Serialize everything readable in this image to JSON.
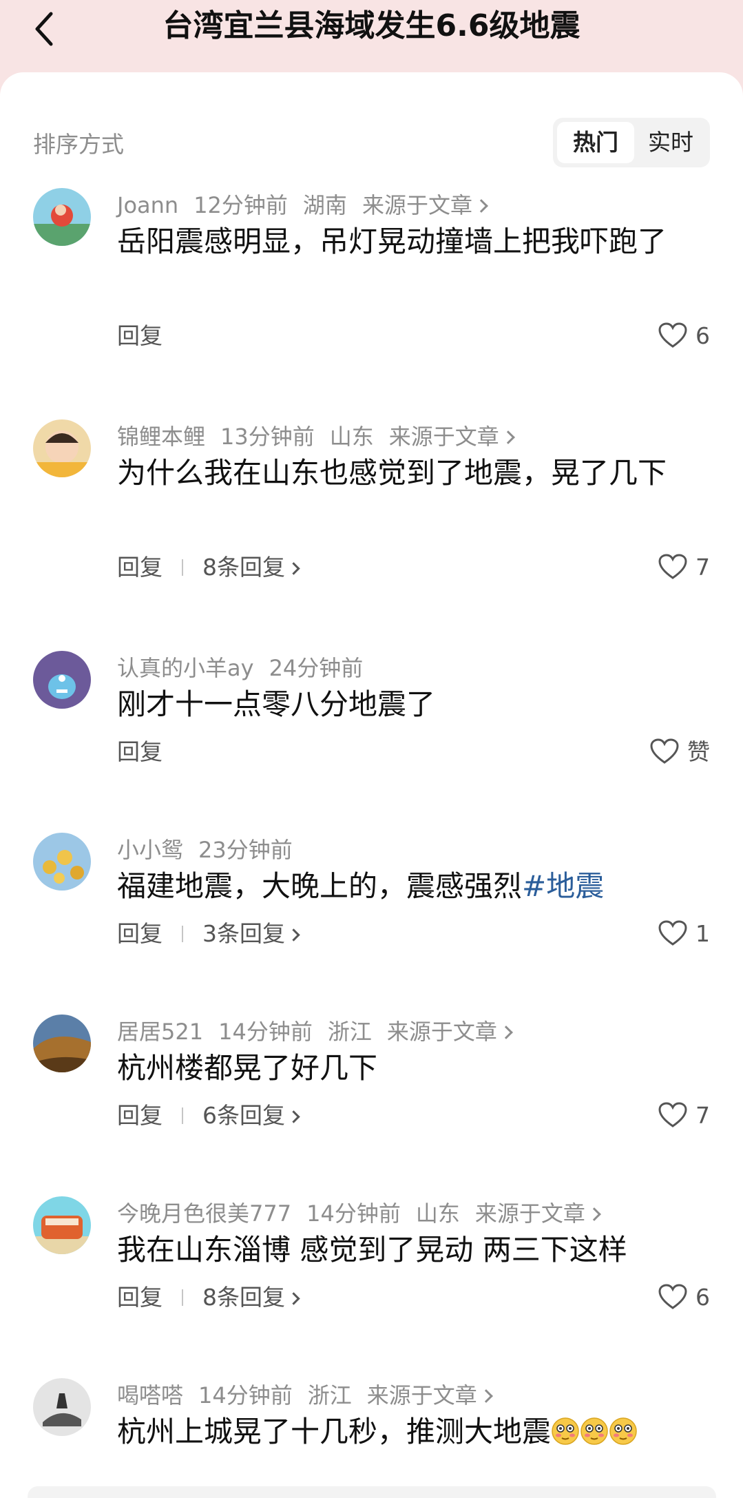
{
  "header": {
    "title": "台湾宜兰县海域发生6.6级地震"
  },
  "sort": {
    "label": "排序方式",
    "hot": "热门",
    "live": "实时"
  },
  "comments": [
    {
      "user": "Joann",
      "time": "12分钟前",
      "location": "湖南",
      "source": "来源于文章",
      "text": "岳阳震感明显，吊灯晃动撞墙上把我吓跑了",
      "reply_label": "回复",
      "replies": "",
      "likes": "6"
    },
    {
      "user": "锦鲤本鲤",
      "time": "13分钟前",
      "location": "山东",
      "source": "来源于文章",
      "text": "为什么我在山东也感觉到了地震，晃了几下",
      "reply_label": "回复",
      "replies": "8条回复",
      "likes": "7"
    },
    {
      "user": "认真的小羊ay",
      "time": "24分钟前",
      "location": "",
      "source": "",
      "text": "刚才十一点零八分地震了",
      "reply_label": "回复",
      "replies": "",
      "likes": "赞"
    },
    {
      "user": "小小鸳",
      "time": "23分钟前",
      "location": "",
      "source": "",
      "text": "福建地震，大晚上的，震感强烈",
      "hashtag": "#地震",
      "reply_label": "回复",
      "replies": "3条回复",
      "likes": "1"
    },
    {
      "user": "居居521",
      "time": "14分钟前",
      "location": "浙江",
      "source": "来源于文章",
      "text": "杭州楼都晃了好几下",
      "reply_label": "回复",
      "replies": "6条回复",
      "likes": "7"
    },
    {
      "user": "今晚月色很美777",
      "time": "14分钟前",
      "location": "山东",
      "source": "来源于文章",
      "text": "我在山东淄博 感觉到了晃动 两三下这样",
      "reply_label": "回复",
      "replies": "8条回复",
      "likes": "6"
    },
    {
      "user": "喝嗒嗒",
      "time": "14分钟前",
      "location": "浙江",
      "source": "来源于文章",
      "text": "杭州上城晃了十几秒，推测大地震",
      "emoji": "flushed-face-emoji",
      "reply_label": "",
      "replies": "",
      "likes": ""
    }
  ],
  "colors": {
    "header_bg": "#f8e4e4",
    "hashtag": "#2a5d9a",
    "meta": "#8d8d8d"
  }
}
